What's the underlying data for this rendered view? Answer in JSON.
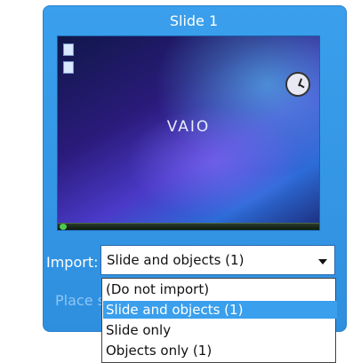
{
  "slide": {
    "title": "Slide 1",
    "thumbnail_logo": "VAIO"
  },
  "import": {
    "label": "Import:",
    "selected": "Slide and objects (1)",
    "options": [
      "(Do not import)",
      "Slide and objects (1)",
      "Slide only",
      "Objects only (1)"
    ],
    "highlighted_index": 1
  },
  "place": {
    "label_partial": "Place sl"
  },
  "colors": {
    "panel": "#3a9fec",
    "highlight": "#3a9fec",
    "text_dim": "#8ec5f2"
  },
  "icons": [
    "clock-icon",
    "dropdown-arrow-icon",
    "desktop-icon",
    "start-button-icon"
  ]
}
